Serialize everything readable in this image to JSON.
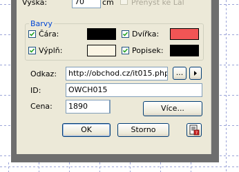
{
  "top": {
    "height_label": "Výška:",
    "height_value": "70",
    "height_unit": "cm",
    "checkbox_label": "Přenýst ke Lal",
    "checkbox_checked": false
  },
  "colors": {
    "legend": "Barvy",
    "items": [
      {
        "label": "Čára:",
        "checked": true,
        "color": "#000000"
      },
      {
        "label": "Dvířka:",
        "checked": true,
        "color": "#f25555"
      },
      {
        "label": "Výplň:",
        "checked": true,
        "color": "#fbf5e4"
      },
      {
        "label": "Popisek:",
        "checked": true,
        "color": "#000000"
      }
    ]
  },
  "link": {
    "label": "Odkaz:",
    "value": "http://obchod.cz/it015.php",
    "browse_label": "...",
    "arrow_icon": "triangle-right-icon"
  },
  "id": {
    "label": "ID:",
    "value": "OWCH015"
  },
  "price": {
    "label": "Cena:",
    "value": "1890",
    "more_label": "Více..."
  },
  "buttons": {
    "ok": "OK",
    "cancel": "Storno",
    "help_icon": "page-help-icon"
  }
}
